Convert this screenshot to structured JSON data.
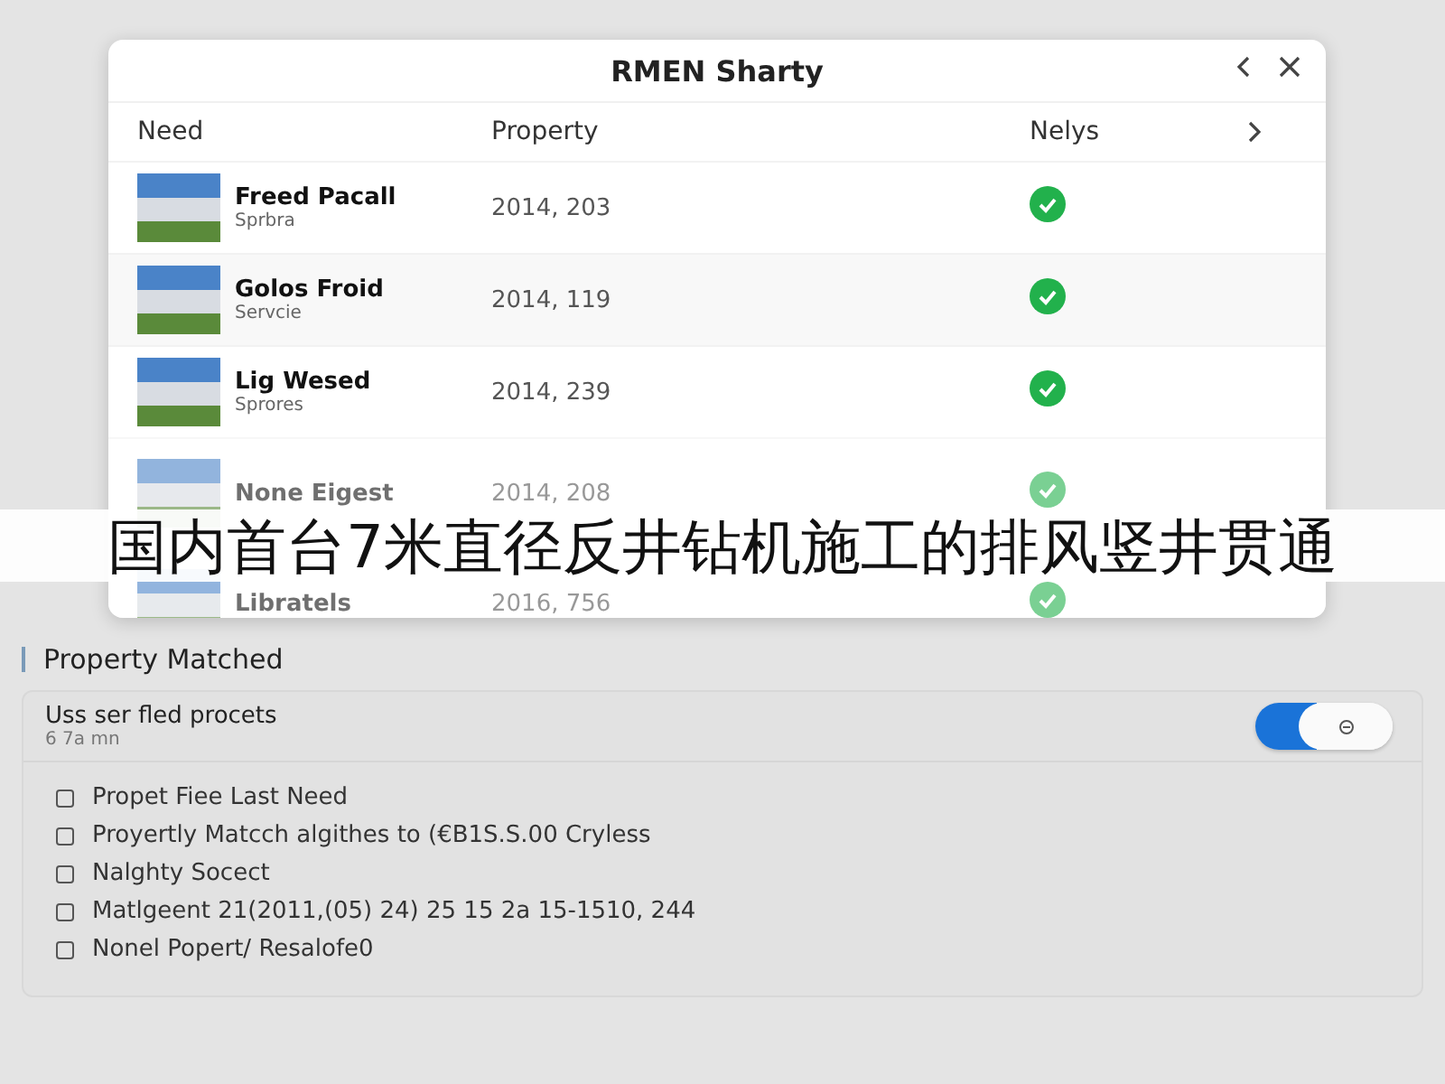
{
  "dialog": {
    "title": "RMEN Sharty",
    "columns": [
      "Need",
      "Property",
      "Nelys"
    ],
    "rows": [
      {
        "name": "Freed Pacall",
        "subtitle": "Sprbra",
        "property": "2014, 203",
        "matched": true,
        "faded": false
      },
      {
        "name": "Golos Froid",
        "subtitle": "Servcie",
        "property": "2014, 119",
        "matched": true,
        "faded": false
      },
      {
        "name": "Lig Wesed",
        "subtitle": "Sprores",
        "property": "2014, 239",
        "matched": true,
        "faded": false
      },
      {
        "name": "None Eigest",
        "property": "2014, 208",
        "matched": true,
        "faded": true
      },
      {
        "name": "Libratels",
        "property": "2016, 756",
        "matched": true,
        "faded": true
      }
    ]
  },
  "caption": "国内首台7米直径反井钻机施工的排风竖井贯通",
  "section": {
    "title": "Property Matched",
    "toggle": {
      "label": "Uss ser fled procets",
      "sublabel": "6 7a mn",
      "on": true
    },
    "items": [
      {
        "label": "Propet Fiee Last Need",
        "checked": false
      },
      {
        "label": "Proyertly Matcch algithes to (€B1S.S.00 Cryless",
        "checked": false
      },
      {
        "label": "Nalghty Socect",
        "checked": false
      },
      {
        "label": "Matlgeent 21(2011,(05) 24) 25 15 2a 15-1510, 244",
        "checked": false
      },
      {
        "label": "Nonel Popert/ Resalofe0",
        "checked": false
      }
    ]
  }
}
